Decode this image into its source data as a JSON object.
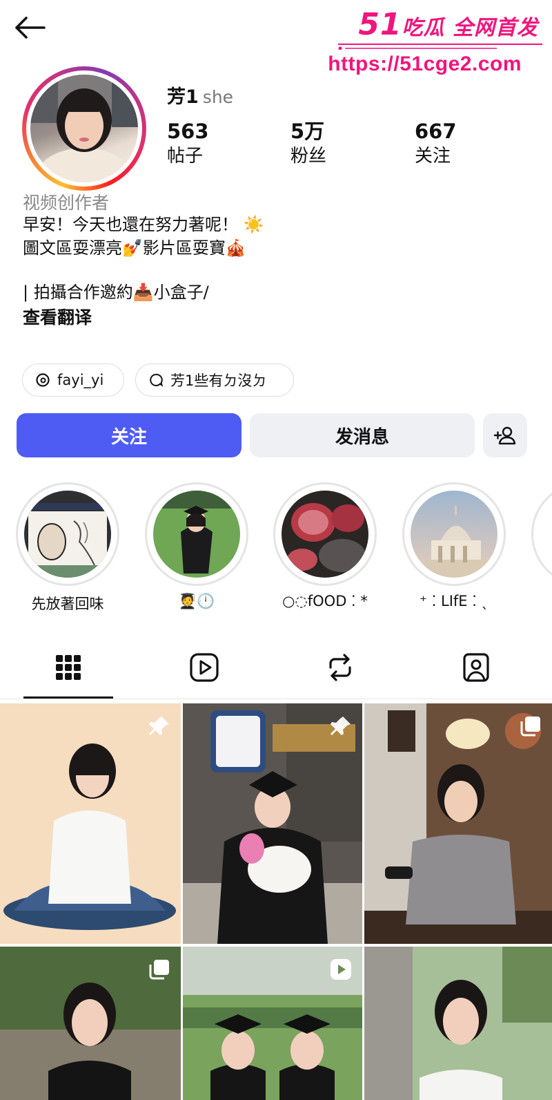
{
  "nav": {
    "back_icon": "arrow-left-icon"
  },
  "watermark": {
    "number": "51",
    "title": "吃瓜 全网首发",
    "url": "https://51cge2.com",
    "color": "#f0157d"
  },
  "profile": {
    "name": "芳1",
    "pronoun": "she",
    "stats": [
      {
        "value": "563",
        "label": "帖子"
      },
      {
        "value": "5万",
        "label": "粉丝"
      },
      {
        "value": "667",
        "label": "关注"
      }
    ],
    "category": "视频创作者",
    "bio_lines": [
      "早安！今天也還在努力著呢！ ☀️",
      "圖文區耍漂亮💅影片區耍寶🎪",
      "",
      "| 拍攝合作邀約📥小盒子/"
    ],
    "translate_link": "查看翻译"
  },
  "chips": [
    {
      "icon": "threads-icon",
      "label": "fayi_yi"
    },
    {
      "icon": "chat-bubble-icon",
      "label": "芳1些有ㄉ沒ㄉ"
    }
  ],
  "actions": {
    "follow": "关注",
    "message": "发消息",
    "add_user_icon": "add-user-icon",
    "accent_color": "#4f5cf4"
  },
  "highlights": [
    {
      "label": "先放著回味"
    },
    {
      "label": "🧑‍🎓🕛"
    },
    {
      "label": "○◌fOOD ⁚ *"
    },
    {
      "label": "⁺ ⁚ LIfE ⁚ ˎ"
    }
  ],
  "tabs": [
    {
      "icon": "grid-icon",
      "active": true
    },
    {
      "icon": "reels-icon",
      "active": false
    },
    {
      "icon": "reposts-icon",
      "active": false
    },
    {
      "icon": "tagged-icon",
      "active": false
    }
  ],
  "posts": [
    {
      "badge": "pin-icon"
    },
    {
      "badge": "pin-icon"
    },
    {
      "badge": "carousel-icon"
    },
    {
      "badge": "carousel-icon"
    },
    {
      "badge": "reel-icon"
    },
    {
      "badge": "none"
    }
  ]
}
